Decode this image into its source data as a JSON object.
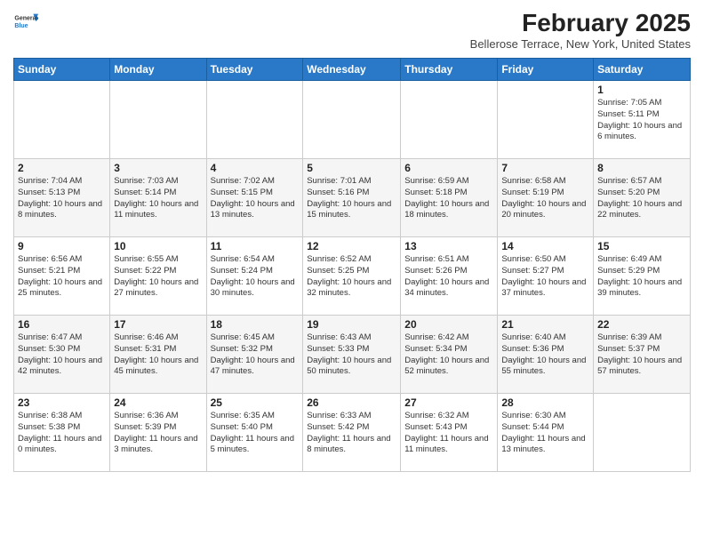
{
  "header": {
    "logo_general": "General",
    "logo_blue": "Blue",
    "month_title": "February 2025",
    "location": "Bellerose Terrace, New York, United States"
  },
  "days_of_week": [
    "Sunday",
    "Monday",
    "Tuesday",
    "Wednesday",
    "Thursday",
    "Friday",
    "Saturday"
  ],
  "weeks": [
    [
      {
        "num": "",
        "info": ""
      },
      {
        "num": "",
        "info": ""
      },
      {
        "num": "",
        "info": ""
      },
      {
        "num": "",
        "info": ""
      },
      {
        "num": "",
        "info": ""
      },
      {
        "num": "",
        "info": ""
      },
      {
        "num": "1",
        "info": "Sunrise: 7:05 AM\nSunset: 5:11 PM\nDaylight: 10 hours and 6 minutes."
      }
    ],
    [
      {
        "num": "2",
        "info": "Sunrise: 7:04 AM\nSunset: 5:13 PM\nDaylight: 10 hours and 8 minutes."
      },
      {
        "num": "3",
        "info": "Sunrise: 7:03 AM\nSunset: 5:14 PM\nDaylight: 10 hours and 11 minutes."
      },
      {
        "num": "4",
        "info": "Sunrise: 7:02 AM\nSunset: 5:15 PM\nDaylight: 10 hours and 13 minutes."
      },
      {
        "num": "5",
        "info": "Sunrise: 7:01 AM\nSunset: 5:16 PM\nDaylight: 10 hours and 15 minutes."
      },
      {
        "num": "6",
        "info": "Sunrise: 6:59 AM\nSunset: 5:18 PM\nDaylight: 10 hours and 18 minutes."
      },
      {
        "num": "7",
        "info": "Sunrise: 6:58 AM\nSunset: 5:19 PM\nDaylight: 10 hours and 20 minutes."
      },
      {
        "num": "8",
        "info": "Sunrise: 6:57 AM\nSunset: 5:20 PM\nDaylight: 10 hours and 22 minutes."
      }
    ],
    [
      {
        "num": "9",
        "info": "Sunrise: 6:56 AM\nSunset: 5:21 PM\nDaylight: 10 hours and 25 minutes."
      },
      {
        "num": "10",
        "info": "Sunrise: 6:55 AM\nSunset: 5:22 PM\nDaylight: 10 hours and 27 minutes."
      },
      {
        "num": "11",
        "info": "Sunrise: 6:54 AM\nSunset: 5:24 PM\nDaylight: 10 hours and 30 minutes."
      },
      {
        "num": "12",
        "info": "Sunrise: 6:52 AM\nSunset: 5:25 PM\nDaylight: 10 hours and 32 minutes."
      },
      {
        "num": "13",
        "info": "Sunrise: 6:51 AM\nSunset: 5:26 PM\nDaylight: 10 hours and 34 minutes."
      },
      {
        "num": "14",
        "info": "Sunrise: 6:50 AM\nSunset: 5:27 PM\nDaylight: 10 hours and 37 minutes."
      },
      {
        "num": "15",
        "info": "Sunrise: 6:49 AM\nSunset: 5:29 PM\nDaylight: 10 hours and 39 minutes."
      }
    ],
    [
      {
        "num": "16",
        "info": "Sunrise: 6:47 AM\nSunset: 5:30 PM\nDaylight: 10 hours and 42 minutes."
      },
      {
        "num": "17",
        "info": "Sunrise: 6:46 AM\nSunset: 5:31 PM\nDaylight: 10 hours and 45 minutes."
      },
      {
        "num": "18",
        "info": "Sunrise: 6:45 AM\nSunset: 5:32 PM\nDaylight: 10 hours and 47 minutes."
      },
      {
        "num": "19",
        "info": "Sunrise: 6:43 AM\nSunset: 5:33 PM\nDaylight: 10 hours and 50 minutes."
      },
      {
        "num": "20",
        "info": "Sunrise: 6:42 AM\nSunset: 5:34 PM\nDaylight: 10 hours and 52 minutes."
      },
      {
        "num": "21",
        "info": "Sunrise: 6:40 AM\nSunset: 5:36 PM\nDaylight: 10 hours and 55 minutes."
      },
      {
        "num": "22",
        "info": "Sunrise: 6:39 AM\nSunset: 5:37 PM\nDaylight: 10 hours and 57 minutes."
      }
    ],
    [
      {
        "num": "23",
        "info": "Sunrise: 6:38 AM\nSunset: 5:38 PM\nDaylight: 11 hours and 0 minutes."
      },
      {
        "num": "24",
        "info": "Sunrise: 6:36 AM\nSunset: 5:39 PM\nDaylight: 11 hours and 3 minutes."
      },
      {
        "num": "25",
        "info": "Sunrise: 6:35 AM\nSunset: 5:40 PM\nDaylight: 11 hours and 5 minutes."
      },
      {
        "num": "26",
        "info": "Sunrise: 6:33 AM\nSunset: 5:42 PM\nDaylight: 11 hours and 8 minutes."
      },
      {
        "num": "27",
        "info": "Sunrise: 6:32 AM\nSunset: 5:43 PM\nDaylight: 11 hours and 11 minutes."
      },
      {
        "num": "28",
        "info": "Sunrise: 6:30 AM\nSunset: 5:44 PM\nDaylight: 11 hours and 13 minutes."
      },
      {
        "num": "",
        "info": ""
      }
    ]
  ]
}
